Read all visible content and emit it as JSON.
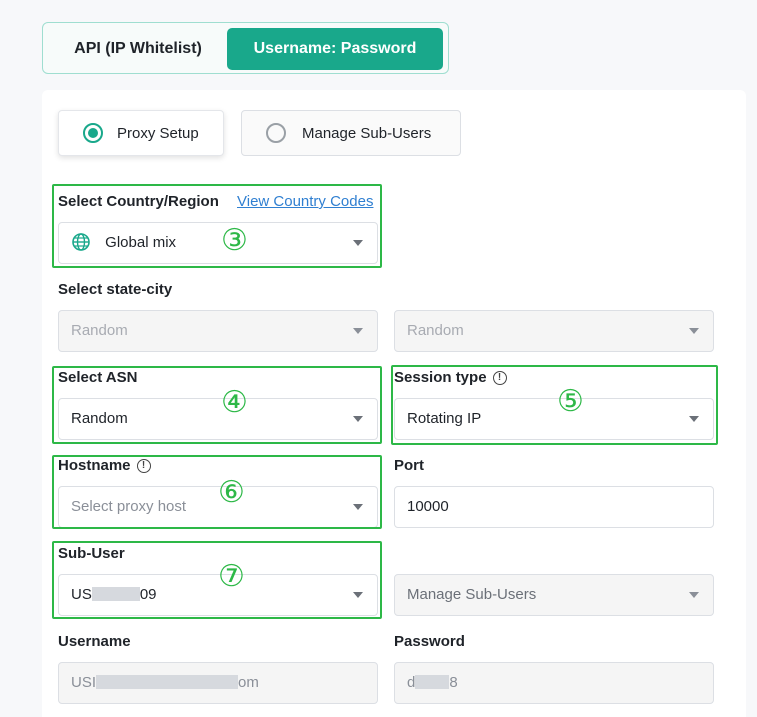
{
  "auth_tabs": {
    "api_label": "API (IP Whitelist)",
    "userpass_label": "Username: Password",
    "active": "Username: Password"
  },
  "mode": {
    "setup_label": "Proxy Setup",
    "subusers_label": "Manage Sub-Users",
    "selected": "Proxy Setup"
  },
  "country": {
    "label": "Select Country/Region",
    "link": "View Country Codes",
    "value": "Global mix"
  },
  "state_city": {
    "label": "Select state-city",
    "state_value": "Random",
    "city_value": "Random"
  },
  "asn": {
    "label": "Select ASN",
    "value": "Random"
  },
  "session": {
    "label": "Session type",
    "value": "Rotating IP"
  },
  "hostname": {
    "label": "Hostname",
    "placeholder": "Select proxy host"
  },
  "port": {
    "label": "Port",
    "value": "10000"
  },
  "subuser": {
    "label": "Sub-User",
    "value_prefix": "US",
    "value_suffix": "09",
    "manage_label": "Manage Sub-Users"
  },
  "credentials": {
    "username_label": "Username",
    "username_prefix": "USI",
    "username_suffix": "om",
    "password_label": "Password",
    "password_prefix": "d",
    "password_suffix": "8"
  },
  "annotations": [
    "③",
    "④",
    "⑤",
    "⑥",
    "⑦"
  ],
  "colors": {
    "accent": "#19a88b",
    "annotation": "#2db847",
    "link": "#2f7fd1"
  }
}
